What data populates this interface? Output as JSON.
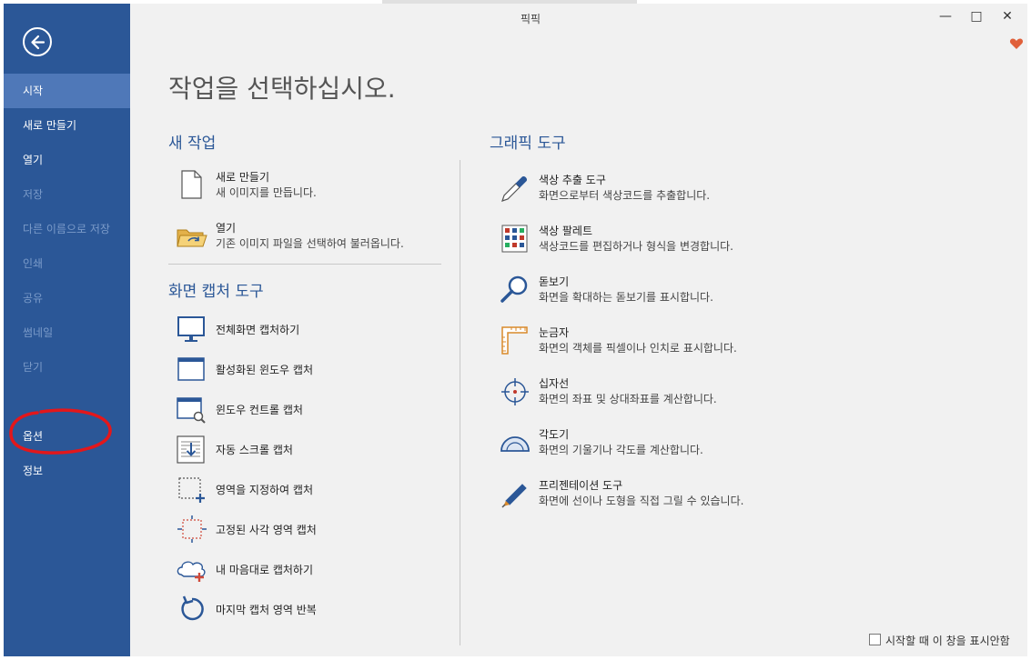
{
  "window": {
    "title": "픽픽",
    "minimize": "—",
    "maximize": "□",
    "close": "✕"
  },
  "sidebar": {
    "items": [
      {
        "label": "시작"
      },
      {
        "label": "새로 만들기"
      },
      {
        "label": "열기"
      },
      {
        "label": "저장"
      },
      {
        "label": "다른 이름으로 저장"
      },
      {
        "label": "인쇄"
      },
      {
        "label": "공유"
      },
      {
        "label": "썸네일"
      },
      {
        "label": "닫기"
      },
      {
        "label": "옵션"
      },
      {
        "label": "정보"
      }
    ]
  },
  "main": {
    "page_title": "작업을 선택하십시오.",
    "new_task": {
      "title": "새 작업",
      "items": [
        {
          "title": "새로 만들기",
          "desc": "새 이미지를 만듭니다."
        },
        {
          "title": "열기",
          "desc": "기존 이미지 파일을 선택하여 불러옵니다."
        }
      ]
    },
    "capture": {
      "title": "화면 캡처 도구",
      "items": [
        {
          "title": "전체화면 캡처하기"
        },
        {
          "title": "활성화된 윈도우 캡처"
        },
        {
          "title": "윈도우 컨트롤 캡처"
        },
        {
          "title": "자동 스크롤 캡처"
        },
        {
          "title": "영역을 지정하여 캡처"
        },
        {
          "title": "고정된 사각 영역 캡처"
        },
        {
          "title": "내 마음대로 캡처하기"
        },
        {
          "title": "마지막 캡처 영역 반복"
        }
      ]
    },
    "graphic": {
      "title": "그래픽 도구",
      "items": [
        {
          "title": "색상 추출 도구",
          "desc": "화면으로부터 색상코드를 추출합니다."
        },
        {
          "title": "색상 팔레트",
          "desc": "색상코드를 편집하거나 형식을 변경합니다."
        },
        {
          "title": "돋보기",
          "desc": "화면을 확대하는 돋보기를 표시합니다."
        },
        {
          "title": "눈금자",
          "desc": "화면의 객체를 픽셀이나 인치로 표시합니다."
        },
        {
          "title": "십자선",
          "desc": "화면의 좌표 및 상대좌표를 계산합니다."
        },
        {
          "title": "각도기",
          "desc": "화면의 기울기나 각도를 계산합니다."
        },
        {
          "title": "프리젠테이션 도구",
          "desc": "화면에 선이나 도형을 직접 그릴 수 있습니다."
        }
      ]
    },
    "footer": {
      "dont_show_label": "시작할 때 이 창을 표시안함",
      "dont_show_checked": false
    }
  },
  "colors": {
    "sidebar": "#2b5797",
    "sidebar_active": "#4f78b8",
    "accent": "#2b5797",
    "annotation": "#e3171b",
    "heart": "#e0603a"
  }
}
